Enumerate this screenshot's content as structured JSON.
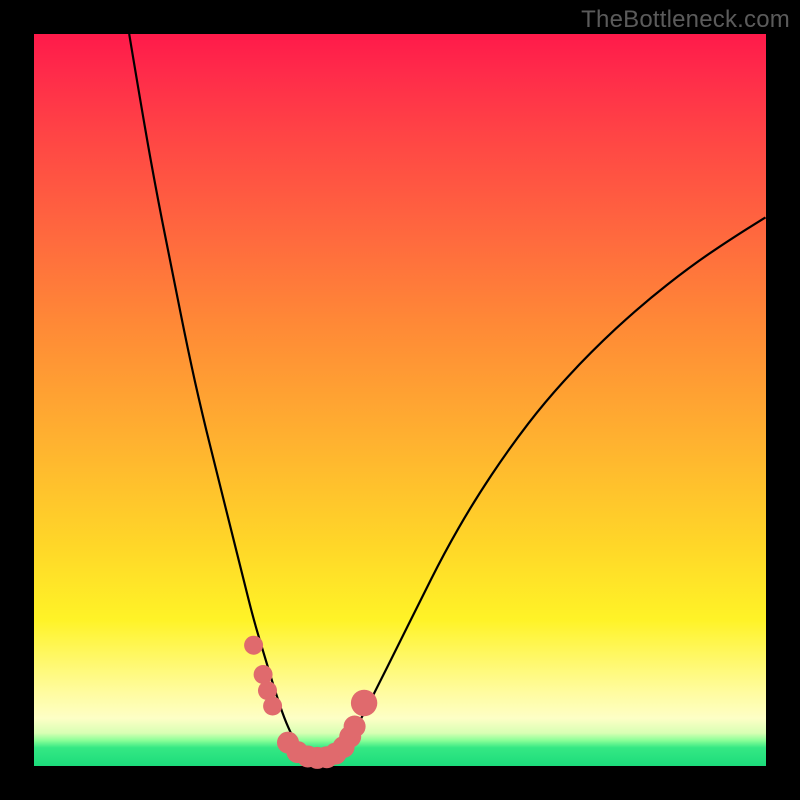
{
  "watermark": "TheBottleneck.com",
  "chart_data": {
    "type": "line",
    "title": "",
    "xlabel": "",
    "ylabel": "",
    "xlim": [
      0,
      100
    ],
    "ylim": [
      0,
      100
    ],
    "grid": false,
    "legend": false,
    "series": [
      {
        "name": "left-curve",
        "x": [
          13,
          15,
          17,
          19,
          21,
          23,
          25,
          27,
          28.5,
          30,
          31.5,
          33,
          34.2,
          35.3,
          36.2
        ],
        "y": [
          100,
          88,
          77,
          67,
          57,
          48,
          40,
          32,
          26,
          20,
          15,
          10,
          6.5,
          4,
          2.5
        ]
      },
      {
        "name": "right-curve",
        "x": [
          42,
          43.5,
          45,
          47,
          49.5,
          52.5,
          56,
          60,
          65,
          70,
          76,
          83,
          90,
          96,
          100
        ],
        "y": [
          2.5,
          4.5,
          7,
          11,
          16,
          22,
          29,
          36,
          43.5,
          50,
          56.5,
          63,
          68.5,
          72.5,
          75
        ]
      }
    ],
    "markers": [
      {
        "x": 30.0,
        "y": 16.5,
        "r": 1.3
      },
      {
        "x": 31.3,
        "y": 12.5,
        "r": 1.3
      },
      {
        "x": 31.9,
        "y": 10.3,
        "r": 1.3
      },
      {
        "x": 32.6,
        "y": 8.2,
        "r": 1.3
      },
      {
        "x": 34.7,
        "y": 3.2,
        "r": 1.5
      },
      {
        "x": 36.0,
        "y": 1.9,
        "r": 1.5
      },
      {
        "x": 37.4,
        "y": 1.3,
        "r": 1.5
      },
      {
        "x": 38.7,
        "y": 1.1,
        "r": 1.5
      },
      {
        "x": 40.0,
        "y": 1.2,
        "r": 1.5
      },
      {
        "x": 41.2,
        "y": 1.7,
        "r": 1.5
      },
      {
        "x": 42.3,
        "y": 2.6,
        "r": 1.5
      },
      {
        "x": 43.2,
        "y": 4.0,
        "r": 1.5
      },
      {
        "x": 43.8,
        "y": 5.4,
        "r": 1.5
      },
      {
        "x": 45.1,
        "y": 8.6,
        "r": 1.8
      }
    ],
    "annotations": []
  }
}
